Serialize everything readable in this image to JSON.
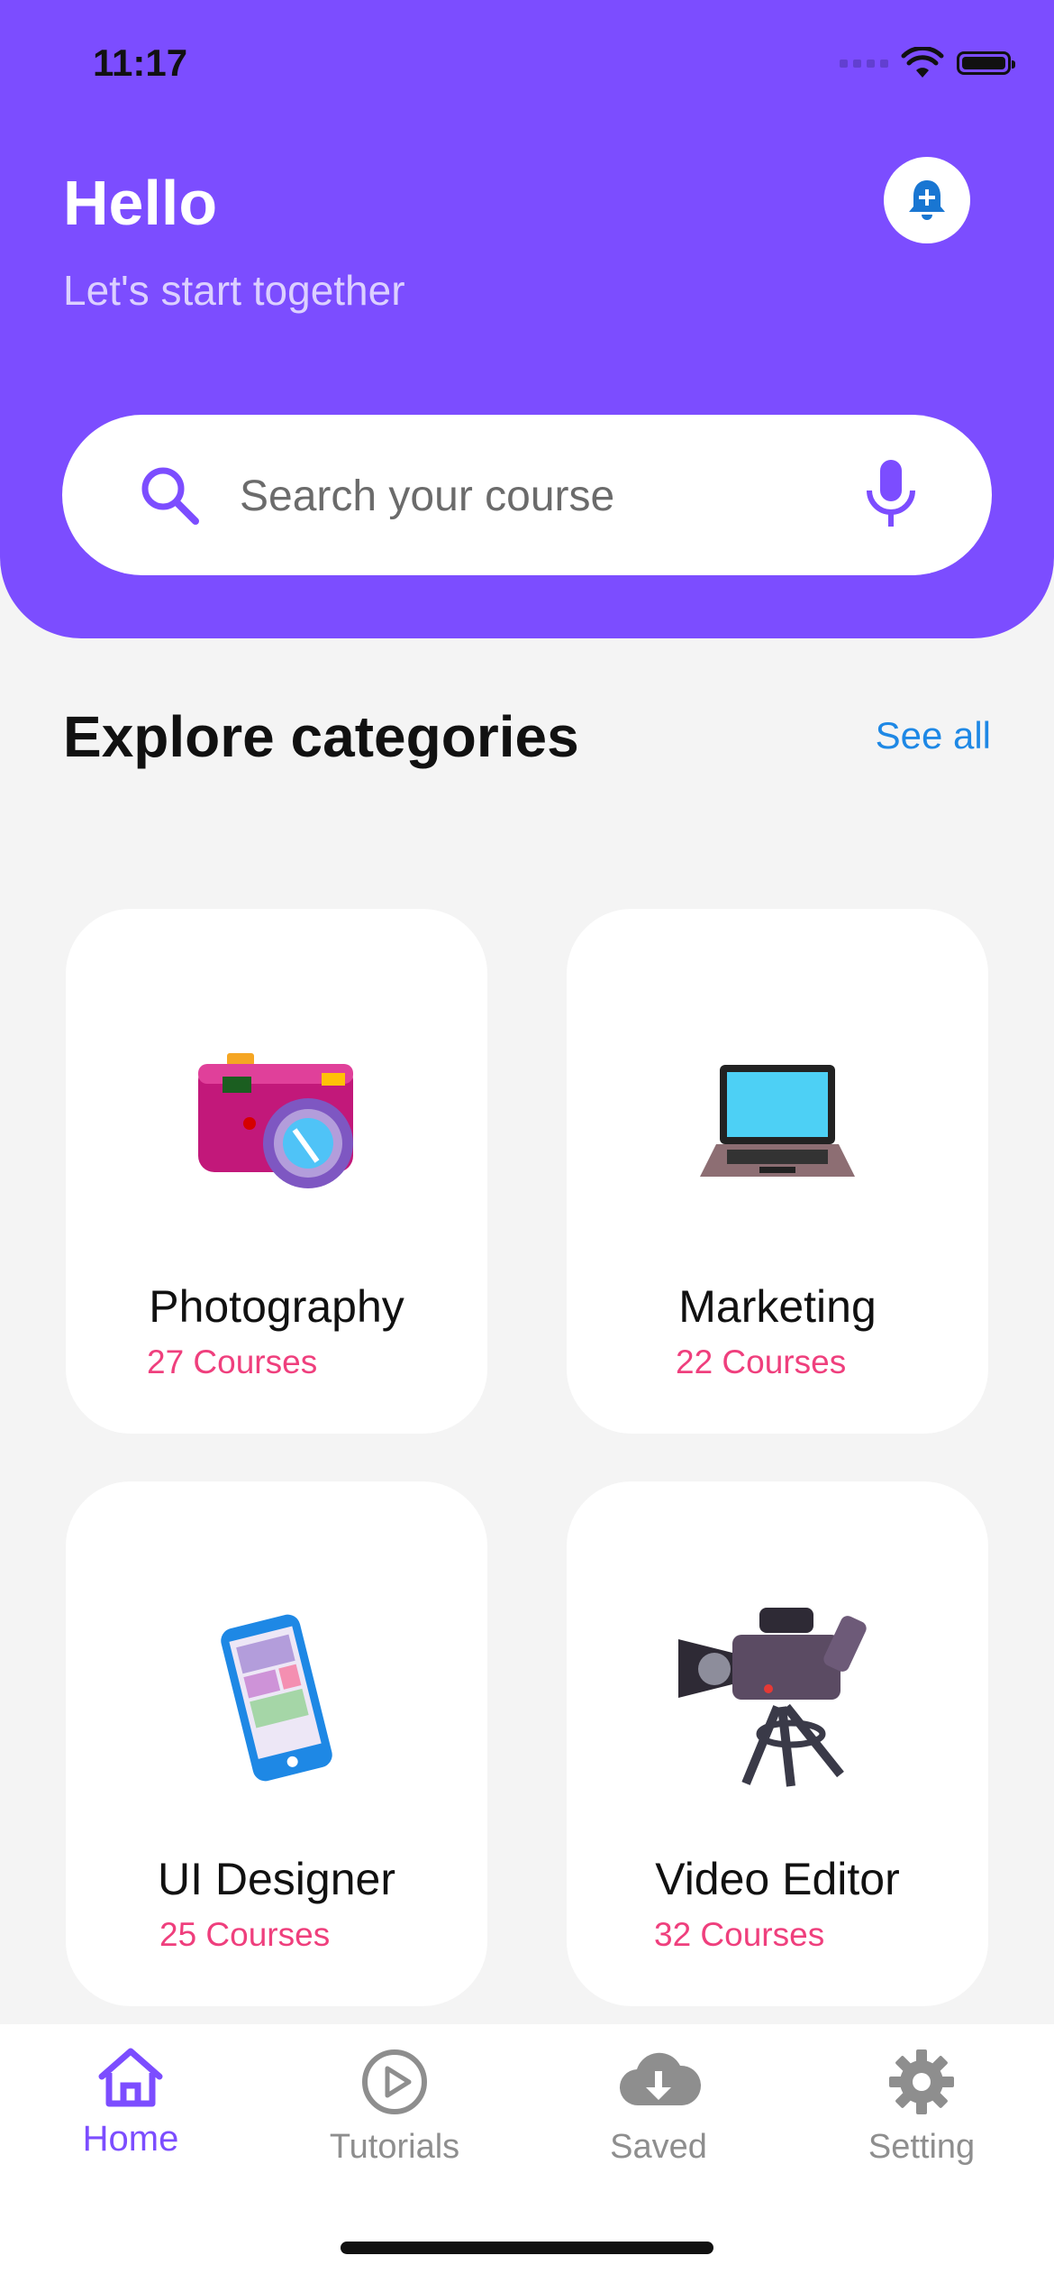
{
  "status": {
    "time": "11:17"
  },
  "header": {
    "greeting": "Hello",
    "subtitle": "Let's start together"
  },
  "search": {
    "placeholder": "Search your course",
    "value": ""
  },
  "section": {
    "title": "Explore categories",
    "see_all": "See all"
  },
  "categories": [
    {
      "name": "Photography",
      "count": "27 Courses",
      "icon": "camera-icon"
    },
    {
      "name": "Marketing",
      "count": "22 Courses",
      "icon": "laptop-icon"
    },
    {
      "name": "UI Designer",
      "count": "25 Courses",
      "icon": "smartphone-icon"
    },
    {
      "name": "Video Editor",
      "count": "32 Courses",
      "icon": "video-camera-icon"
    }
  ],
  "tabs": [
    {
      "label": "Home",
      "icon": "home-icon",
      "active": true
    },
    {
      "label": "Tutorials",
      "icon": "play-circle-icon",
      "active": false
    },
    {
      "label": "Saved",
      "icon": "cloud-download-icon",
      "active": false
    },
    {
      "label": "Setting",
      "icon": "gear-icon",
      "active": false
    }
  ],
  "colors": {
    "accent": "#7c4dff",
    "count_text": "#ef3f7d",
    "link": "#1e88e5"
  }
}
